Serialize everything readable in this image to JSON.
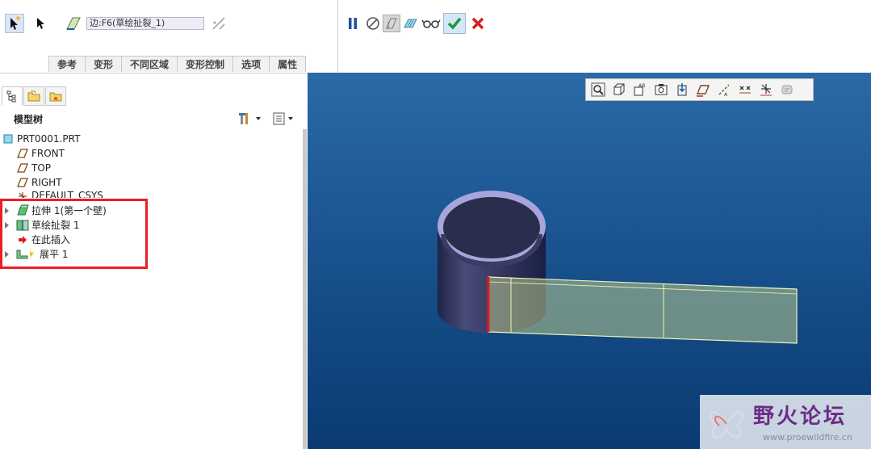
{
  "ribbon": {
    "edge_field_value": "边:F6(草绘扯裂_1)",
    "tabs": [
      "参考",
      "变形",
      "不同区域",
      "变形控制",
      "选项",
      "属性"
    ]
  },
  "model_tree": {
    "title": "模型树",
    "items": [
      {
        "label": "PRT0001.PRT",
        "icon": "part-icon"
      },
      {
        "label": "FRONT",
        "icon": "datum-plane-icon"
      },
      {
        "label": "TOP",
        "icon": "datum-plane-icon"
      },
      {
        "label": "RIGHT",
        "icon": "datum-plane-icon"
      },
      {
        "label": "DEFAULT_CSYS",
        "icon": "csys-icon"
      },
      {
        "label": "拉伸 1(第一个壁)",
        "icon": "extrude-wall-icon"
      },
      {
        "label": "草绘扯裂 1",
        "icon": "sketch-rip-icon"
      },
      {
        "label": "在此插入",
        "icon": "insert-here-arrow-icon"
      },
      {
        "label": "展平 1",
        "icon": "flatten-icon"
      }
    ]
  },
  "watermark": {
    "title": "野火论坛",
    "url": "www.proewildfire.cn"
  },
  "colors": {
    "highlight": "#ee1c25",
    "confirm": "#1a9a3a",
    "cancel": "#d81e1e",
    "pause": "#1f4f9c",
    "viewport_top": "#2a6aa6",
    "viewport_bottom": "#0b3a73"
  }
}
